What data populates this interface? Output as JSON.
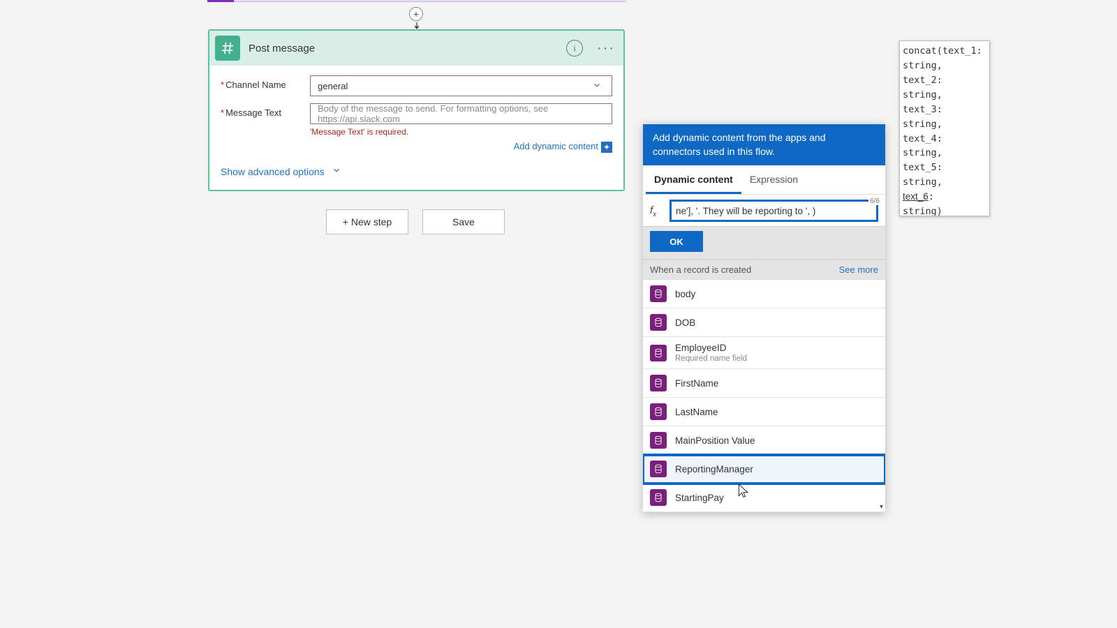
{
  "card": {
    "title": "Post message",
    "channel_label": "Channel Name",
    "channel_value": "general",
    "message_label": "Message Text",
    "message_placeholder": "Body of the message to send. For formatting options, see https://api.slack.com",
    "message_error": "'Message Text' is required.",
    "add_dynamic": "Add dynamic content",
    "show_advanced": "Show advanced options"
  },
  "buttons": {
    "new_step": "+ New step",
    "save": "Save"
  },
  "flyout": {
    "banner": "Add dynamic content from the apps and connectors used in this flow.",
    "tab_dynamic": "Dynamic content",
    "tab_expression": "Expression",
    "page": "6/6",
    "expr_value": "ne'], '. They will be reporting to ', )",
    "ok": "OK",
    "group": "When a record is created",
    "see_more": "See more",
    "items": [
      {
        "label": "body"
      },
      {
        "label": "DOB"
      },
      {
        "label": "EmployeeID",
        "sub": "Required name field"
      },
      {
        "label": "FirstName"
      },
      {
        "label": "LastName"
      },
      {
        "label": "MainPosition Value"
      },
      {
        "label": "ReportingManager",
        "highlight": true
      },
      {
        "label": "StartingPay"
      }
    ]
  },
  "tooltip": {
    "lines": [
      "concat(text_1:",
      "string,",
      "text_2:",
      "string,",
      "text_3:",
      "string,",
      "text_4:",
      "string,",
      "text_5:",
      "string,"
    ],
    "u": "text_6",
    "tail": [
      ":",
      "string)"
    ]
  }
}
